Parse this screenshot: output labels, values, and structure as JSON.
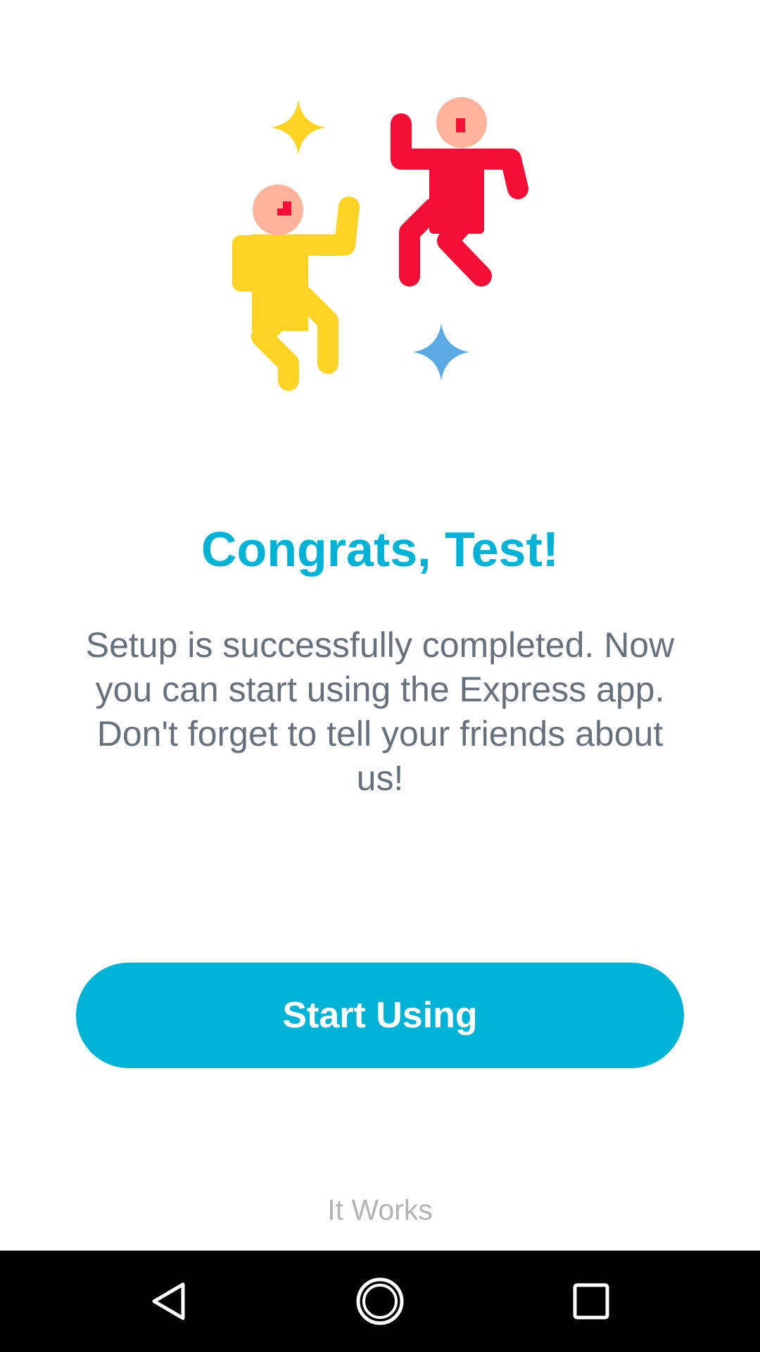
{
  "congrats": {
    "title": "Congrats, Test!",
    "message": "Setup is successfully completed. Now you can start using the Express app. Don't forget to tell your friends about us!",
    "primary_button_label": "Start Using",
    "footer_label": "It Works"
  },
  "illustration": {
    "icon": "celebrating-people-illustration"
  },
  "nav_bar": {
    "back_icon": "back-triangle-icon",
    "home_icon": "home-circle-icon",
    "recents_icon": "recents-square-icon"
  },
  "colors": {
    "accent": "#00B2D6",
    "body_text": "#67717C",
    "footer_text": "#B3B3B3",
    "person_yellow": "#FFD324",
    "person_red": "#F30E36",
    "skin": "#FFB39A",
    "sparkle_yellow": "#FFD324",
    "sparkle_blue": "#5BAAE6",
    "nav_bar_bg": "#000000"
  }
}
